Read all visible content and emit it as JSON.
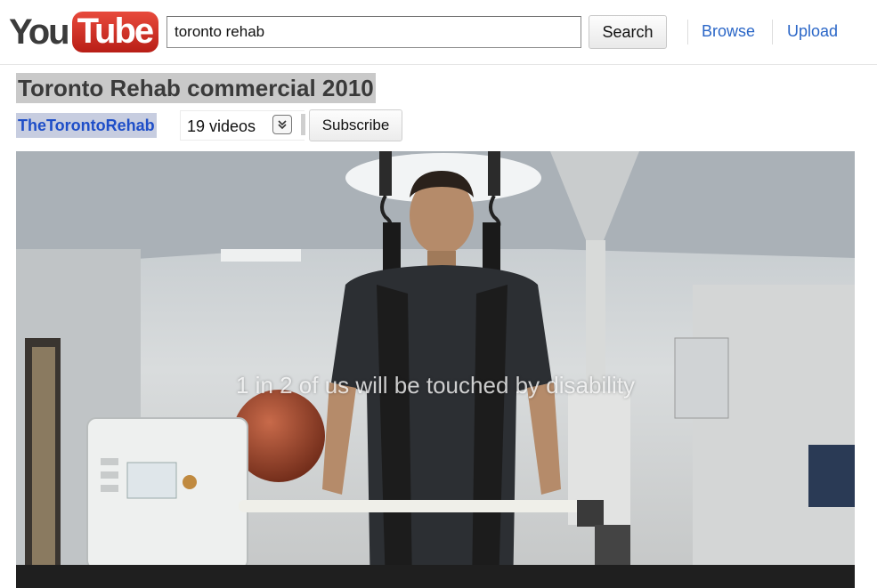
{
  "header": {
    "logo": {
      "part1": "You",
      "part2": "Tube"
    },
    "search": {
      "value": "toronto rehab",
      "button_label": "Search"
    },
    "nav": {
      "browse": "Browse",
      "upload": "Upload"
    }
  },
  "video": {
    "title": "Toronto Rehab commercial 2010",
    "channel": "TheTorontoRehab",
    "video_count": "19 videos",
    "subscribe_label": "Subscribe",
    "caption": "1 in 2 of us will be touched by disability"
  },
  "colors": {
    "link_blue": "#2a66c7",
    "logo_red": "#d3291c",
    "title_highlight": "#c9c9c9",
    "channel_highlight": "#c7cde0"
  },
  "icons": {
    "expand": "chevron-double-down-icon"
  }
}
